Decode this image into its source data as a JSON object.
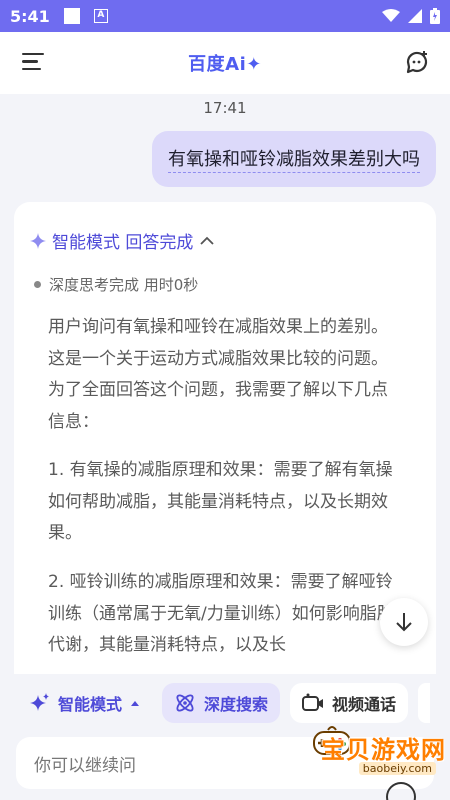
{
  "status_bar": {
    "time": "5:41",
    "notif_letter": "A"
  },
  "header": {
    "title": "百度Ai✦"
  },
  "chat": {
    "timestamp": "17:41",
    "user_message": "有氧操和哑铃减脂效果差别大吗",
    "answer": {
      "mode_label": "智能模式 回答完成",
      "thinking_status": "深度思考完成 用时0秒",
      "paragraphs": [
        "用户询问有氧操和哑铃在减脂效果上的差别。这是一个关于运动方式减脂效果比较的问题。为了全面回答这个问题，我需要了解以下几点信息：",
        "1. 有氧操的减脂原理和效果：需要了解有氧操如何帮助减脂，其能量消耗特点，以及长期效果。",
        "2. 哑铃训练的减脂原理和效果：需要了解哑铃训练（通常属于无氧/力量训练）如何影响脂肪代谢，其能量消耗特点，以及长"
      ]
    }
  },
  "toolbar": {
    "mode_label": "智能模式",
    "search_label": "深度搜索",
    "video_label": "视频通话"
  },
  "input": {
    "placeholder": "你可以继续问"
  },
  "watermark": {
    "title": "宝贝游戏网",
    "url": "baobeiy.com"
  },
  "colors": {
    "accent": "#4e4ad8",
    "status_bar": "#6f6cf0",
    "user_bubble": "#dcd9fa",
    "watermark": "#ff7f00"
  }
}
